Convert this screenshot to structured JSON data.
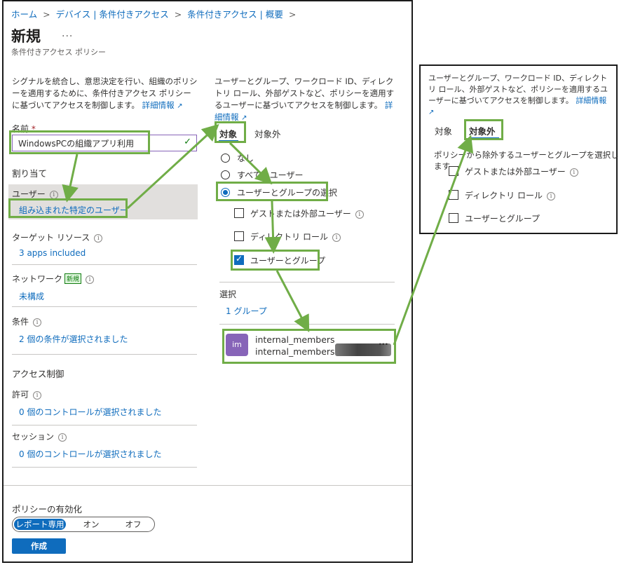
{
  "breadcrumb": [
    "ホーム",
    "デバイス | 条件付きアクセス",
    "条件付きアクセス | 概要"
  ],
  "page": {
    "title": "新規",
    "more": "...",
    "subtitle": "条件付きアクセス ポリシー"
  },
  "left": {
    "description": "シグナルを統合し、意思決定を行い、組織のポリシーを適用するために、条件付きアクセス ポリシーに基づいてアクセスを制御します。",
    "learn_more": "詳細情報",
    "name_label": "名前",
    "required_mark": "*",
    "name_value": "WindowsPCの組織アプリ利用",
    "assignments_heading": "割り当て",
    "users_label": "ユーザー",
    "users_value": "組み込まれた特定のユーザー",
    "target_label": "ターゲット リソース",
    "target_value": "3 apps included",
    "network_label": "ネットワーク",
    "network_badge": "新規",
    "network_value": "未構成",
    "conditions_label": "条件",
    "conditions_value": "2 個の条件が選択されました",
    "access_heading": "アクセス制御",
    "grant_label": "許可",
    "grant_value": "0 個のコントロールが選択されました",
    "session_label": "セッション",
    "session_value": "0 個のコントロールが選択されました"
  },
  "middle": {
    "description": "ユーザーとグループ、ワークロード ID、ディレクトリ ロール、外部ゲストなど、ポリシーを適用するユーザーに基づいてアクセスを制御します。",
    "learn_more": "詳細情報",
    "tab_include": "対象",
    "tab_exclude": "対象外",
    "radio_none": "なし",
    "radio_all": "すべてのユーザー",
    "radio_select": "ユーザーとグループの選択",
    "cb_guest": "ゲストまたは外部ユーザー",
    "cb_roles": "ディレクトリ ロール",
    "cb_users_groups": "ユーザーとグループ",
    "select_label": "選択",
    "select_value": "1 グループ",
    "member_initials": "im",
    "member_name": "internal_members",
    "member_email": "internal_members@",
    "member_more": "..."
  },
  "footer": {
    "enable_label": "ポリシーの有効化",
    "toggle": [
      "レポート専用",
      "オン",
      "オフ"
    ],
    "create_button": "作成"
  },
  "popup": {
    "description": "ユーザーとグループ、ワークロード ID、ディレクトリ ロール、外部ゲストなど、ポリシーを適用するユーザーに基づいてアクセスを制御します。",
    "learn_more": "詳細情報",
    "tab_include": "対象",
    "tab_exclude": "対象外",
    "exclude_text": "ポリシーから除外するユーザーとグループを選択します",
    "cb_guest": "ゲストまたは外部ユーザー",
    "cb_roles": "ディレクトリ ロール",
    "cb_users_groups": "ユーザーとグループ"
  },
  "colors": {
    "accent": "#0f6cbd",
    "highlight": "#70ad47",
    "selected_row": "#e1dfdd"
  }
}
